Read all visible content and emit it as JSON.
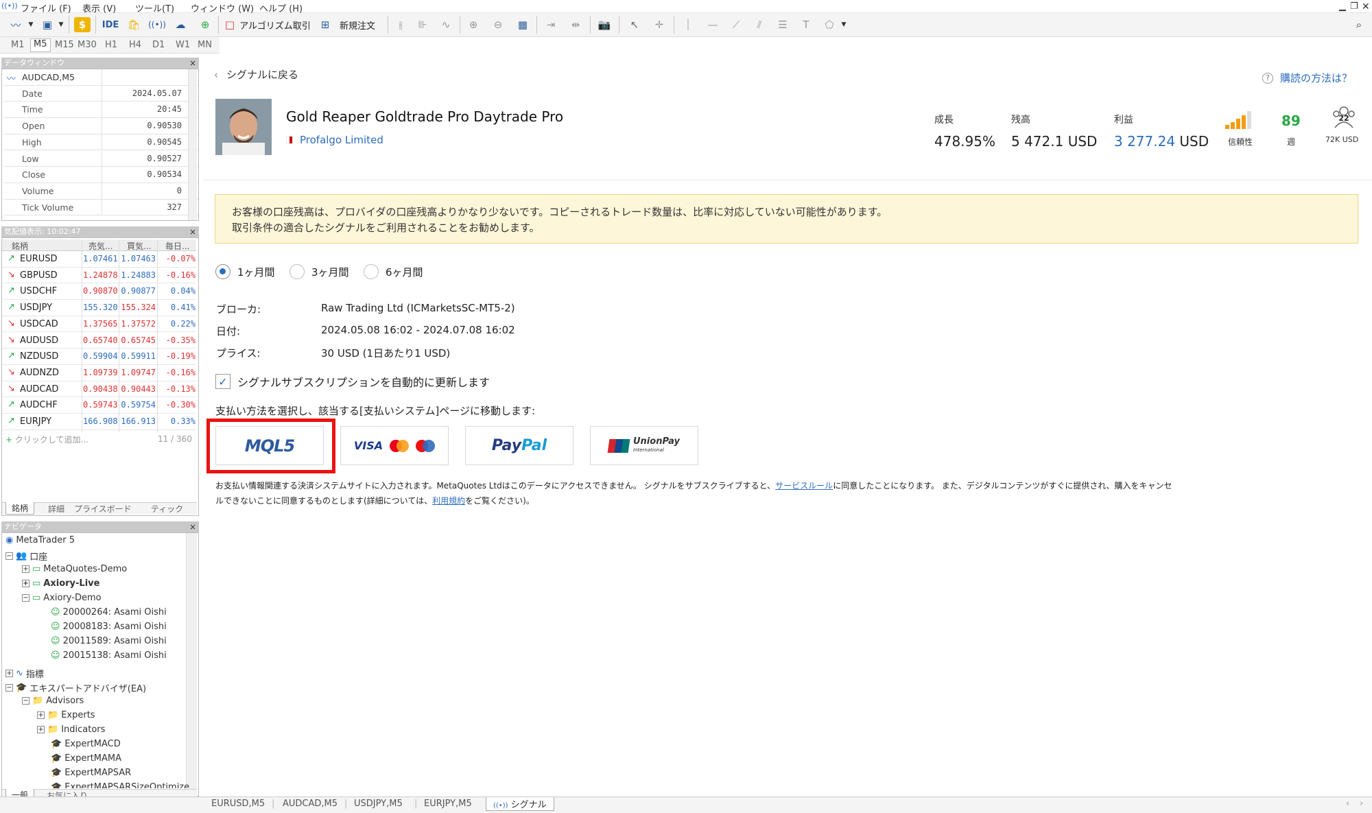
{
  "menu": [
    "ファイル (F)",
    "表示 (V)",
    "ツール(T)",
    "ウィンドウ (W)",
    "ヘルプ (H)"
  ],
  "toolbar": {
    "ide": "IDE",
    "algo": "アルゴリズム取引",
    "new_order": "新規注文"
  },
  "timeframes": [
    "M1",
    "M5",
    "M15",
    "M30",
    "H1",
    "H4",
    "D1",
    "W1",
    "MN"
  ],
  "data_window": {
    "title": "データウィンドウ",
    "symbol": "AUDCAD,M5",
    "rows": [
      {
        "k": "Date",
        "v": "2024.05.07"
      },
      {
        "k": "Time",
        "v": "20:45"
      },
      {
        "k": "Open",
        "v": "0.90530"
      },
      {
        "k": "High",
        "v": "0.90545"
      },
      {
        "k": "Low",
        "v": "0.90527"
      },
      {
        "k": "Close",
        "v": "0.90534"
      },
      {
        "k": "Volume",
        "v": "0"
      },
      {
        "k": "Tick Volume",
        "v": "327"
      }
    ]
  },
  "market_watch": {
    "title": "気配値表示: 10:02:47",
    "headers": [
      "銘柄",
      "売気...",
      "買気...",
      "毎日..."
    ],
    "rows": [
      {
        "s": "EURUSD",
        "b": "1.07461",
        "a": "1.07463",
        "c": "-0.07%",
        "dir": "up",
        "bc": "#2d6cc0",
        "ac": "#2d6cc0",
        "cc": "#e03030"
      },
      {
        "s": "GBPUSD",
        "b": "1.24878",
        "a": "1.24883",
        "c": "-0.16%",
        "dir": "down",
        "bc": "#e03030",
        "ac": "#2d6cc0",
        "cc": "#e03030"
      },
      {
        "s": "USDCHF",
        "b": "0.90870",
        "a": "0.90877",
        "c": "0.04%",
        "dir": "up",
        "bc": "#e03030",
        "ac": "#2d6cc0",
        "cc": "#2d6cc0"
      },
      {
        "s": "USDJPY",
        "b": "155.320",
        "a": "155.324",
        "c": "0.41%",
        "dir": "up",
        "bc": "#2d6cc0",
        "ac": "#e03030",
        "cc": "#2d6cc0"
      },
      {
        "s": "USDCAD",
        "b": "1.37565",
        "a": "1.37572",
        "c": "0.22%",
        "dir": "down",
        "bc": "#e03030",
        "ac": "#e03030",
        "cc": "#2d6cc0"
      },
      {
        "s": "AUDUSD",
        "b": "0.65740",
        "a": "0.65745",
        "c": "-0.35%",
        "dir": "down",
        "bc": "#e03030",
        "ac": "#e03030",
        "cc": "#e03030"
      },
      {
        "s": "NZDUSD",
        "b": "0.59904",
        "a": "0.59911",
        "c": "-0.19%",
        "dir": "up",
        "bc": "#2d6cc0",
        "ac": "#2d6cc0",
        "cc": "#e03030"
      },
      {
        "s": "AUDNZD",
        "b": "1.09739",
        "a": "1.09747",
        "c": "-0.16%",
        "dir": "down",
        "bc": "#e03030",
        "ac": "#e03030",
        "cc": "#e03030"
      },
      {
        "s": "AUDCAD",
        "b": "0.90438",
        "a": "0.90443",
        "c": "-0.13%",
        "dir": "down",
        "bc": "#e03030",
        "ac": "#e03030",
        "cc": "#e03030"
      },
      {
        "s": "AUDCHF",
        "b": "0.59743",
        "a": "0.59754",
        "c": "-0.30%",
        "dir": "up",
        "bc": "#e03030",
        "ac": "#2d6cc0",
        "cc": "#e03030"
      },
      {
        "s": "EURJPY",
        "b": "166.908",
        "a": "166.913",
        "c": "0.33%",
        "dir": "up",
        "bc": "#2d6cc0",
        "ac": "#2d6cc0",
        "cc": "#2d6cc0"
      }
    ],
    "add": "クリックして追加...",
    "count": "11 / 360",
    "tabs": [
      "銘柄",
      "詳細",
      "プライスボード",
      "ティック"
    ]
  },
  "navigator": {
    "title": "ナビゲータ",
    "root": "MetaTrader 5",
    "accounts": "口座",
    "acc_items": [
      "MetaQuotes-Demo",
      "Axiory-Live",
      "Axiory-Demo"
    ],
    "users": [
      "20000264: Asami Oishi",
      "20008183: Asami Oishi",
      "20011589: Asami Oishi",
      "20015138: Asami Oishi"
    ],
    "indicators": "指標",
    "ea": "エキスパートアドバイザ(EA)",
    "advisors": "Advisors",
    "experts": "Experts",
    "ind_folder": "Indicators",
    "eas": [
      "ExpertMACD",
      "ExpertMAMA",
      "ExpertMAPSAR",
      "ExpertMAPSARSizeOptimize"
    ],
    "tabs": [
      "一般",
      "お気に入り"
    ]
  },
  "signal": {
    "back": "シグナルに戻る",
    "how": "購読の方法は？",
    "title": "Gold Reaper Goldtrade Pro Daytrade Pro",
    "provider": "Profalgo Limited",
    "growth_lbl": "成長",
    "growth": "478.95%",
    "balance_lbl": "残高",
    "balance": "5 472.1 USD",
    "profit_lbl": "利益",
    "profit": "3 277.24",
    "profit_cur": "USD",
    "reliability": "信頼性",
    "weeks": "89",
    "weeks_lbl": "週",
    "subs_num": "22",
    "subs": "72K USD",
    "warning1": "お客様の口座残高は、プロバイダの口座残高よりかなり少ないです。コピーされるトレード数量は、比率に対応していない可能性があります。",
    "warning2": "取引条件の適合したシグナルをご利用されることをお勧めします。",
    "periods": [
      "1ヶ月間",
      "3ヶ月間",
      "6ヶ月間"
    ],
    "broker_k": "ブローカ:",
    "broker_v": "Raw Trading Ltd (ICMarketsSC-MT5-2)",
    "date_k": "日付:",
    "date_v": "2024.05.08 16:02 - 2024.07.08 16:02",
    "price_k": "プライス:",
    "price_v": "30 USD (1日あたり1 USD)",
    "auto_renew": "シグナルサブスクリプションを自動的に更新します",
    "choose": "支払い方法を選択し、該当する[支払いシステム]ページに移動します:",
    "pay_mql5": "MQL5",
    "pay_visa": "VISA",
    "pay_paypal_a": "Pay",
    "pay_paypal_b": "Pal",
    "pay_union": "UnionPay",
    "pay_union_sub": "International",
    "footer_a": "お支払い情報関連する決済システムサイトに入力されます。MetaQuotes Ltdはこのデータにアクセスできません。 シグナルをサブスクライブすると、",
    "footer_link1": "サービスルール",
    "footer_b": "に同意したことになります。 また、デジタルコンテンツがすぐに提供され、購入をキャンセ",
    "footer_c": "ルできないことに同意するものとします(詳細については、",
    "footer_link2": "利用規約",
    "footer_d": "をご覧ください)。"
  },
  "status_tabs": [
    "EURUSD,M5",
    "AUDCAD,M5",
    "USDJPY,M5",
    "EURJPY,M5",
    "シグナル"
  ],
  "colors": {
    "accent": "#2d6cc0",
    "green": "#28a745",
    "red": "#e03030",
    "highlight": "#e11"
  }
}
